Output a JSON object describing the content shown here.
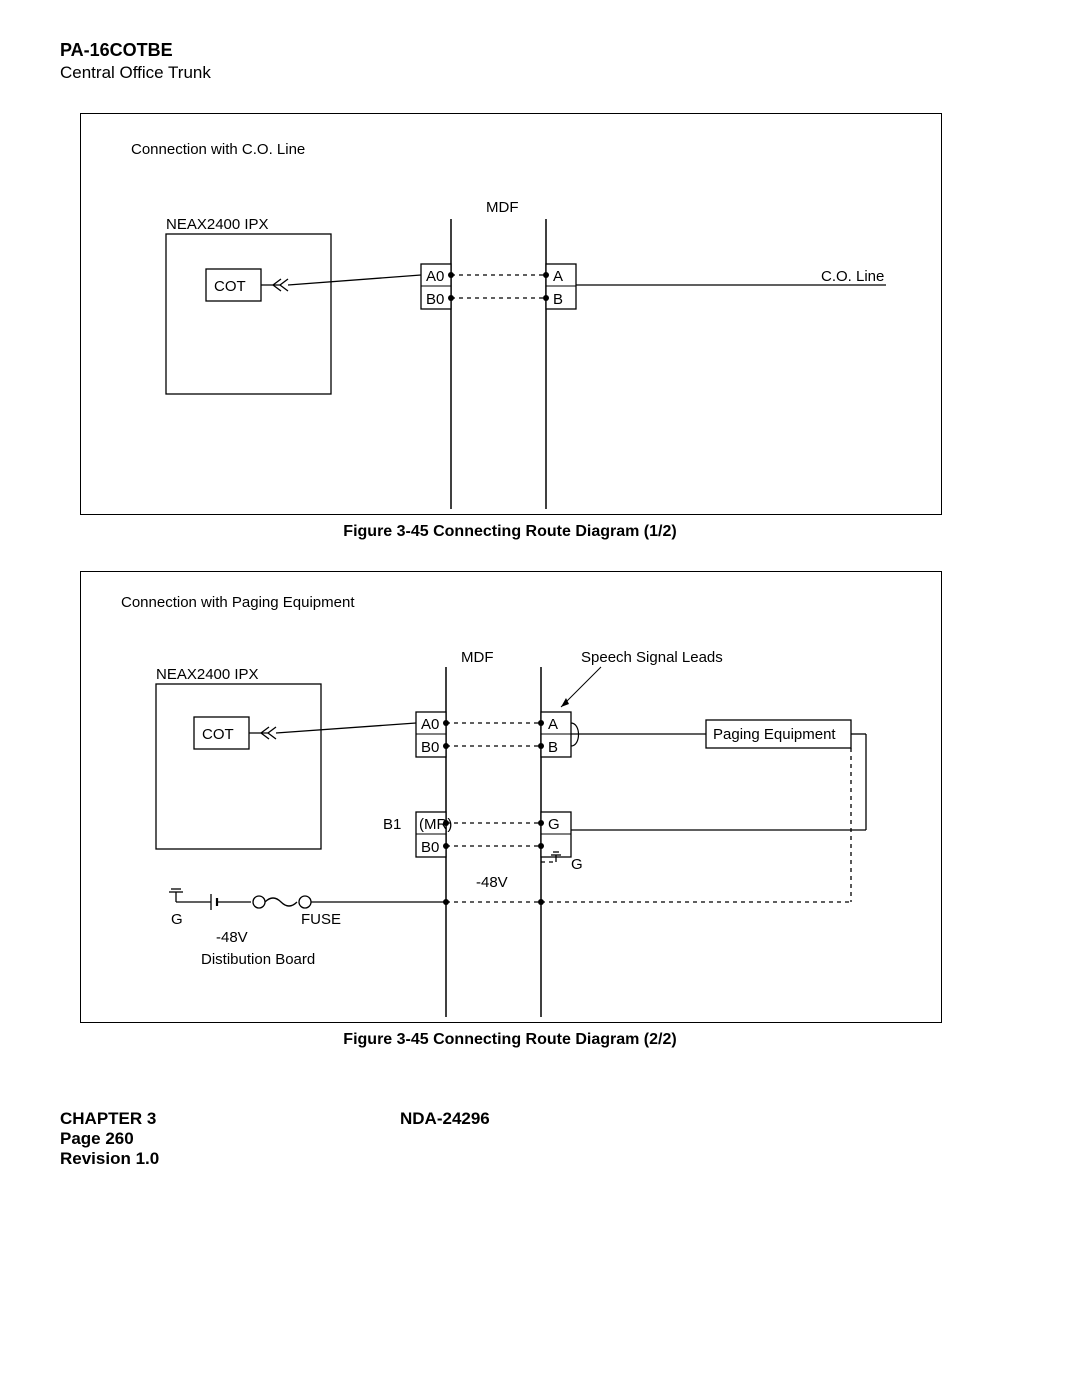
{
  "header": {
    "title": "PA-16COTBE",
    "subtitle": "Central Office Trunk"
  },
  "fig1": {
    "caption": "Figure 3-45   Connecting Route Diagram (1/2)",
    "labels": {
      "conn": "Connection with C.O. Line",
      "neax": "NEAX2400 IPX",
      "cot": "COT",
      "mdf": "MDF",
      "a0": "A0",
      "b0": "B0",
      "a": "A",
      "b": "B",
      "coline": "C.O. Line"
    }
  },
  "fig2": {
    "caption": "Figure 3-45   Connecting Route Diagram (2/2)",
    "labels": {
      "conn": "Connection with Paging Equipment",
      "neax": "NEAX2400 IPX",
      "cot": "COT",
      "mdf": "MDF",
      "speech": "Speech Signal Leads",
      "paging": "Paging Equipment",
      "a0": "A0",
      "b0": "B0",
      "a": "A",
      "b": "B",
      "b1": "B1",
      "mr": "(MR)",
      "b0_2": "B0",
      "g": "G",
      "g2": "G",
      "g3": "G",
      "m48": "-48V",
      "m48_2": "-48V",
      "fuse": "FUSE",
      "dist": "Distibution Board"
    }
  },
  "footer": {
    "chapter": "CHAPTER 3",
    "nda": "NDA-24296",
    "page": "Page 260",
    "rev": "Revision 1.0"
  }
}
